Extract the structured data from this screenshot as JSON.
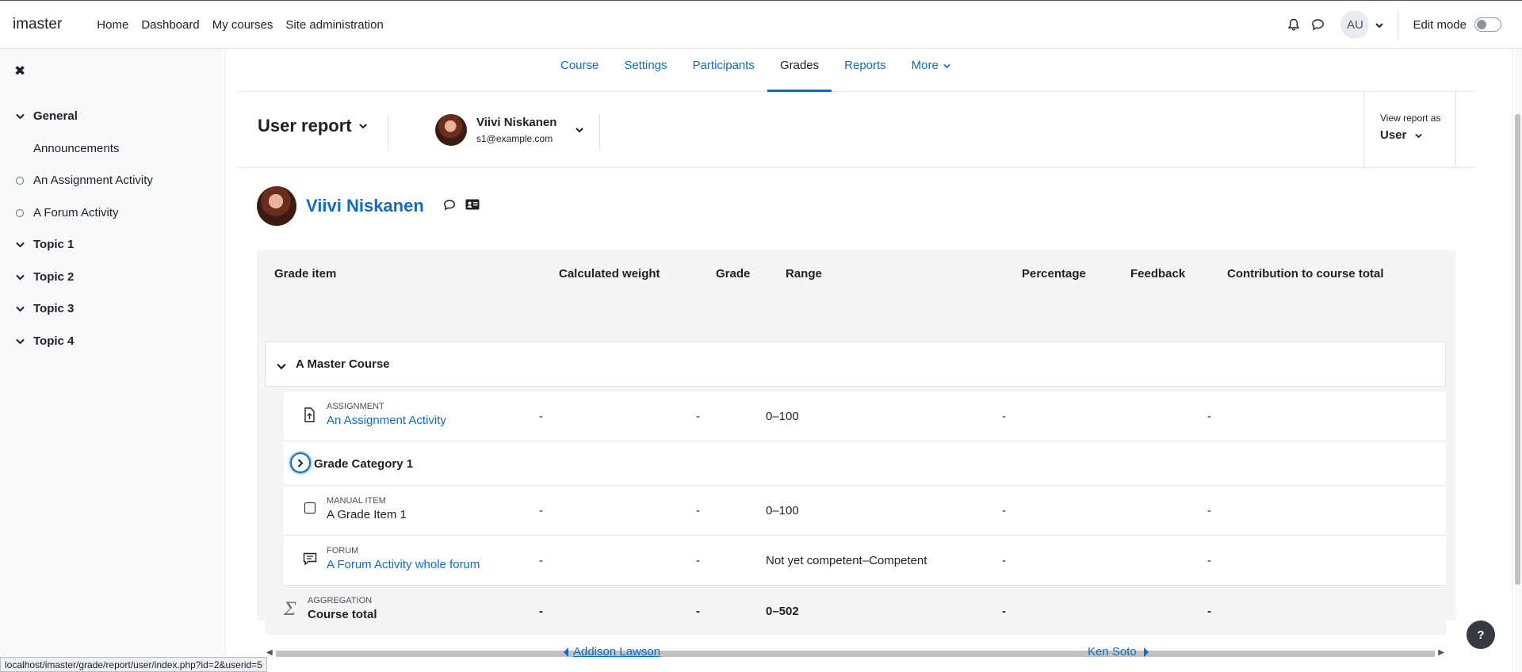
{
  "navbar": {
    "brand": "imaster",
    "links": [
      "Home",
      "Dashboard",
      "My courses",
      "Site administration"
    ],
    "avatar_initials": "AU",
    "edit_mode_label": "Edit mode"
  },
  "sidebar": {
    "items": [
      {
        "label": "General",
        "kind": "section"
      },
      {
        "label": "Announcements",
        "kind": "activity-plain"
      },
      {
        "label": "An Assignment Activity",
        "kind": "activity"
      },
      {
        "label": "A Forum Activity",
        "kind": "activity"
      },
      {
        "label": "Topic 1",
        "kind": "section"
      },
      {
        "label": "Topic 2",
        "kind": "section"
      },
      {
        "label": "Topic 3",
        "kind": "section"
      },
      {
        "label": "Topic 4",
        "kind": "section"
      }
    ]
  },
  "course_nav": {
    "tabs": [
      "Course",
      "Settings",
      "Participants",
      "Grades",
      "Reports",
      "More"
    ],
    "active": "Grades"
  },
  "report_bar": {
    "title": "User report",
    "user_name": "Viivi Niskanen",
    "user_email": "s1@example.com",
    "view_as_label": "View report as",
    "view_as_value": "User"
  },
  "user_heading": {
    "name": "Viivi Niskanen"
  },
  "grade_table": {
    "headers": [
      "Grade item",
      "Calculated weight",
      "Grade",
      "Range",
      "Percentage",
      "Feedback",
      "Contribution to course total"
    ],
    "course_category": "A Master Course",
    "rows": [
      {
        "type": "ASSIGNMENT",
        "name": "An Assignment Activity",
        "weight": "-",
        "grade": "-",
        "range": "0–100",
        "percentage": "-",
        "feedback": "",
        "contribution": "-"
      },
      {
        "category": "Grade Category 1"
      },
      {
        "type": "MANUAL ITEM",
        "name": "A Grade Item 1",
        "weight": "-",
        "grade": "-",
        "range": "0–100",
        "percentage": "-",
        "feedback": "",
        "contribution": "-"
      },
      {
        "type": "FORUM",
        "name": "A Forum Activity whole forum",
        "weight": "-",
        "grade": "-",
        "range": "Not yet competent–Competent",
        "percentage": "-",
        "feedback": "",
        "contribution": "-"
      }
    ],
    "total": {
      "type": "AGGREGATION",
      "name": "Course total",
      "weight": "-",
      "grade": "-",
      "range": "0–502",
      "percentage": "-",
      "contribution": "-"
    }
  },
  "pager": {
    "prev": "Addison Lawson",
    "next": "Ken Soto"
  },
  "help_label": "?",
  "status_url": "localhost/imaster/grade/report/user/index.php?id=2&userid=5"
}
